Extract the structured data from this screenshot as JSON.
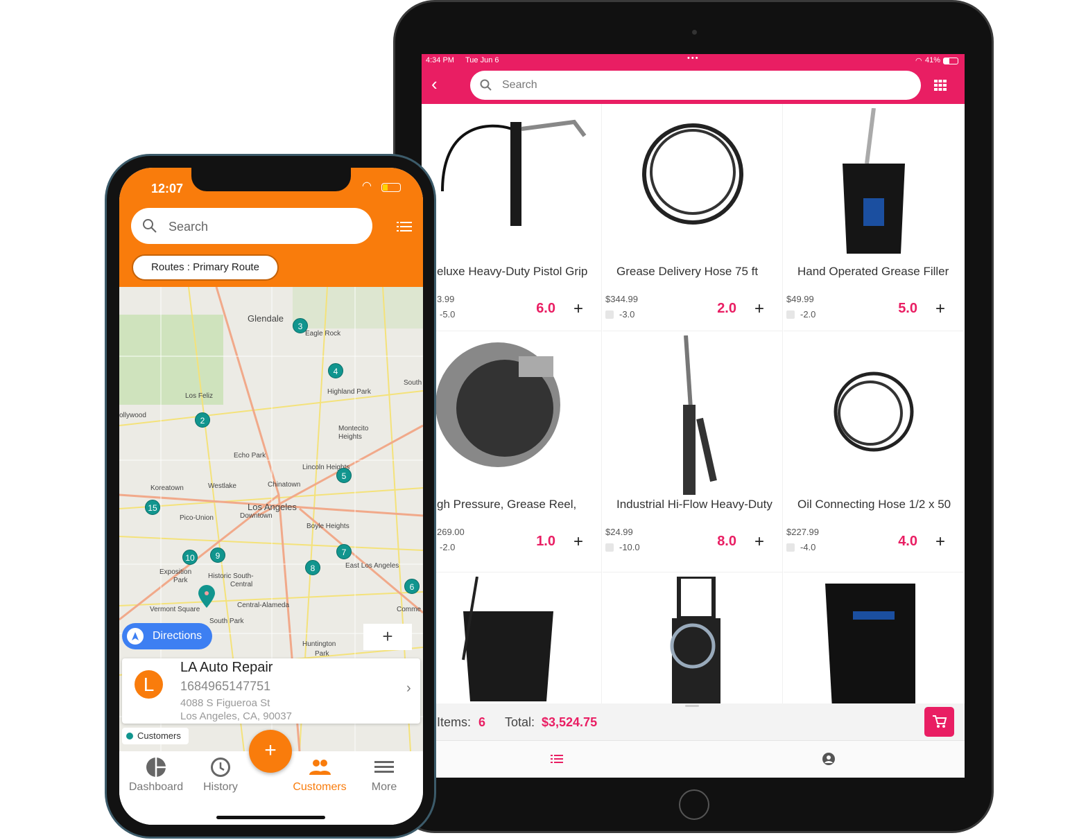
{
  "tablet": {
    "status": {
      "time": "4:34 PM",
      "date": "Tue Jun 6",
      "battery": "41%"
    },
    "search_placeholder": "Search",
    "accent": "#e91e63",
    "products": [
      {
        "name": "eluxe Heavy-Duty Pistol Grip",
        "price": "3.99",
        "stock": "-5.0",
        "qty": "6.0"
      },
      {
        "name": "Grease Delivery Hose 75 ft",
        "price": "$344.99",
        "stock": "-3.0",
        "qty": "2.0"
      },
      {
        "name": "Hand Operated Grease Filler",
        "price": "$49.99",
        "stock": "-2.0",
        "qty": "5.0"
      },
      {
        "name": "gh Pressure, Grease Reel,",
        "price": "269.00",
        "stock": "-2.0",
        "qty": "1.0"
      },
      {
        "name": "Industrial Hi-Flow Heavy-Duty",
        "price": "$24.99",
        "stock": "-10.0",
        "qty": "8.0"
      },
      {
        "name": "Oil Connecting Hose 1/2  x 50",
        "price": "$227.99",
        "stock": "-4.0",
        "qty": "4.0"
      }
    ],
    "summary": {
      "items_label": "Items:",
      "items_value": "6",
      "total_label": "Total:",
      "total_value": "$3,524.75"
    },
    "plus_label": "+"
  },
  "phone": {
    "status": {
      "time": "12:07"
    },
    "search_placeholder": "Search",
    "route_label": "Routes : Primary Route",
    "accent": "#f97c0c",
    "markers": [
      "3",
      "4",
      "2",
      "5",
      "15",
      "10",
      "9",
      "7",
      "8",
      "6"
    ],
    "map_labels": [
      "Glendale",
      "Eagle Rock",
      "Highland Park",
      "Los Feliz",
      "Montecito",
      "Heights",
      "Echo Park",
      "Lincoln Heights",
      "Koreatown",
      "Westlake",
      "Chinatown",
      "Los Angeles",
      "Downtown",
      "Pico-Union",
      "Boyle Heights",
      "Exposition",
      "Park",
      "Historic South-",
      "Central",
      "East Los Angeles",
      "Vermont Square",
      "Central-Alameda",
      "South Park",
      "Huntington",
      "Park",
      "South",
      "Comme",
      "ollywood"
    ],
    "directions_label": "Directions",
    "zoom_plus": "+",
    "customer": {
      "initial": "L",
      "name": "LA Auto Repair",
      "phone": "1684965147751",
      "address1": "4088 S Figueroa St",
      "address2": "Los Angeles, CA, 90037"
    },
    "legend": "Customers",
    "fab": "+",
    "tabs": [
      {
        "label": "Dashboard"
      },
      {
        "label": "History"
      },
      {
        "label": "Customers"
      },
      {
        "label": "More"
      }
    ]
  }
}
